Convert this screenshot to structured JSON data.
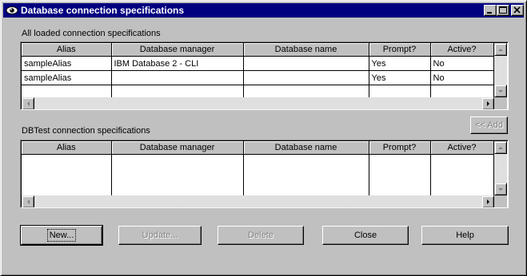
{
  "window": {
    "title": "Database connection specifications",
    "icon": "eye-icon",
    "controls": [
      "minimize-icon",
      "maximize-icon",
      "close-icon"
    ]
  },
  "loaded_section": {
    "label": "All loaded connection specifications",
    "columns": [
      "Alias",
      "Database manager",
      "Database name",
      "Prompt?",
      "Active?"
    ],
    "rows": [
      [
        "sampleAlias",
        "IBM Database 2 - CLI",
        "",
        "Yes",
        "No"
      ],
      [
        "sampleAlias",
        "",
        "",
        "Yes",
        "No"
      ]
    ]
  },
  "add_button": {
    "label": "<< Add",
    "enabled": false
  },
  "dbtest_section": {
    "label": "DBTest connection specifications",
    "columns": [
      "Alias",
      "Database manager",
      "Database name",
      "Prompt?",
      "Active?"
    ],
    "rows": []
  },
  "buttons": {
    "new": "New...",
    "update": "Update...",
    "delete": "Delete",
    "close": "Close",
    "help": "Help"
  },
  "colors": {
    "titlebar": "#000080",
    "face": "#c0c0c0",
    "disabled_text": "#808080"
  }
}
